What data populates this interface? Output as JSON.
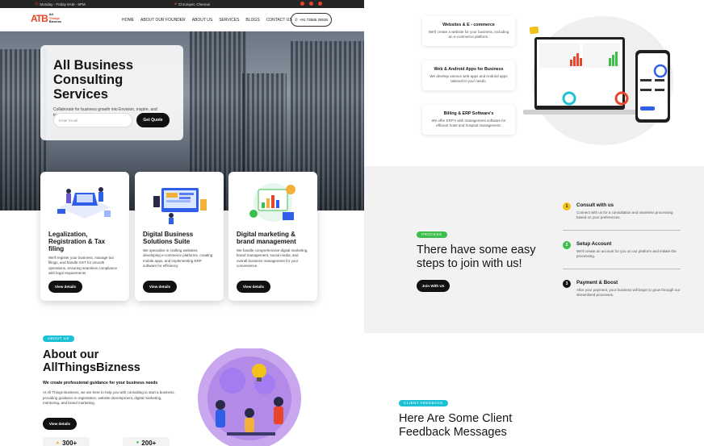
{
  "topbar": {
    "hours": "Monday - Friday 8AM - 9PM",
    "location": "Chrompet, Chennai"
  },
  "brand": {
    "logo_mark": "ATB",
    "logo_line1": "All",
    "logo_line2": "Things",
    "logo_line3": "Bizness",
    "accent": "#e8452b"
  },
  "nav": {
    "items": [
      "HOME",
      "ABOUT OUR FOUNDER",
      "ABOUT US",
      "SERVICES",
      "BLOGS",
      "CONTACT US"
    ],
    "phone": "+91 73585 28536"
  },
  "hero": {
    "title_line1": "All Business",
    "title_line2": "Consulting Services",
    "subtitle": "Collaborate for business growth into Envision, inspire, and transform with expert analytics in scaling.",
    "email_placeholder": "Enter Email",
    "cta": "Get Quote"
  },
  "services": [
    {
      "title": "Legalization, Registration & Tax filing",
      "desc": "We'll register your business, manage tax filings, and handle GST for smooth operations, ensuring seamless compliance with legal requirements",
      "cta": "View details"
    },
    {
      "title": "Digital Business Solutions Suite",
      "desc": "We specialize in crafting websites, developing e-commerce platforms, creating mobile apps, and implementing ERP software for efficiency.",
      "cta": "View details"
    },
    {
      "title": "Digital marketing & brand management",
      "desc": "We handle comprehensive digital marketing, brand management, social media, and overall business management for your convenience.",
      "cta": "View details"
    }
  ],
  "about": {
    "tag": "ABOUT US",
    "title_line1": "About our",
    "title_line2": "AllThingsBizness",
    "lead": "We create professional guidance for your business needs",
    "desc": "At All Things Business, we are here to help you with consulting to start a business, providing guidance in registration, website development, digital marketing, mentoring, and brand marketing.",
    "cta": "View details",
    "stat1": "300+",
    "stat2": "200+"
  },
  "features": [
    {
      "title": "Websites & E - commerce",
      "desc": "We'll create a website for your business, including an e-commerce platform."
    },
    {
      "title": "Web & Android Apps for Business",
      "desc": "We develop various web apps and Android apps tailored to your needs."
    },
    {
      "title": "Billing & ERP Software's",
      "desc": "We offer ERP's with management software for efficient hotel and hospital management."
    }
  ],
  "process": {
    "tag": "PROCESS",
    "title": "There have some easy steps to join with us!",
    "cta": "Join With Us",
    "steps": [
      {
        "num": "1",
        "title": "Consult with us",
        "desc": "Connect with us for a consultation and seamless processing based on your preferences.",
        "color": "#f2c21b"
      },
      {
        "num": "2",
        "title": "Setup Account",
        "desc": "We'll create an account for you on our platform and initiate the processing.",
        "color": "#3bbf4a"
      },
      {
        "num": "3",
        "title": "Payment & Boost",
        "desc": "After your payment, your business will begin to grow through our streamlined processes.",
        "color": "#111111"
      }
    ]
  },
  "feedback": {
    "tag": "CLIENT FEEDBACK",
    "title_line1": "Here Are Some Client",
    "title_line2": "Feedback Messages"
  }
}
